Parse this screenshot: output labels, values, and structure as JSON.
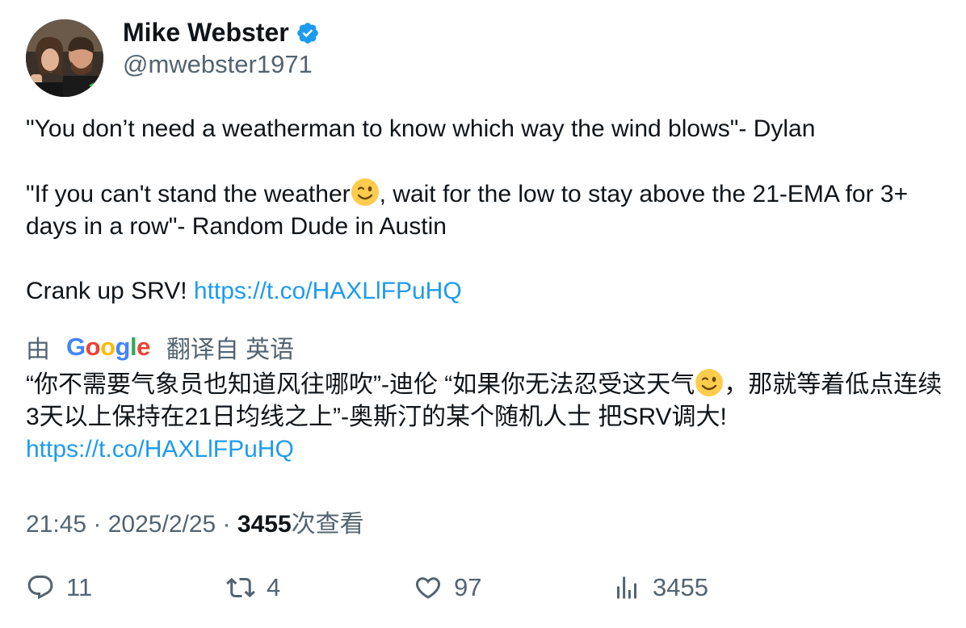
{
  "author": {
    "name": "Mike Webster",
    "handle": "@mwebster1971",
    "verified": true
  },
  "tweet": {
    "line1": "\"You don’t need a weatherman to know which way the wind blows\"- Dylan",
    "line2_before_emoji": "\"If you can't stand the weather",
    "line2_after_emoji": ", wait for the low to stay above the 21-EMA for 3+ days in a row\"- Random Dude in Austin",
    "line3_prefix": "Crank up SRV! ",
    "link": "https://t.co/HAXLlFPuHQ",
    "emoji": "winking-face-emoji"
  },
  "translation": {
    "by_label": "由",
    "provider": "Google",
    "translated_from_label": "翻译自 英语",
    "text_before_emoji": "“你不需要气象员也知道风往哪吹”-迪伦 “如果你无法忍受这天气",
    "text_after_emoji": "，那就等着低点连续3天以上保持在21日均线之上”-奥斯汀的某个随机人士 把SRV调大! ",
    "link": "https://t.co/HAXLlFPuHQ"
  },
  "meta": {
    "time": "21:45",
    "separator": " · ",
    "date": "2025/2/25",
    "views_count": "3455",
    "views_label": "次查看"
  },
  "actions": {
    "replies": "11",
    "retweets": "4",
    "likes": "97",
    "views": "3455"
  },
  "colors": {
    "text": "#0f1419",
    "secondary": "#536471",
    "link": "#1d9bf0",
    "verified": "#1d9bf0"
  }
}
